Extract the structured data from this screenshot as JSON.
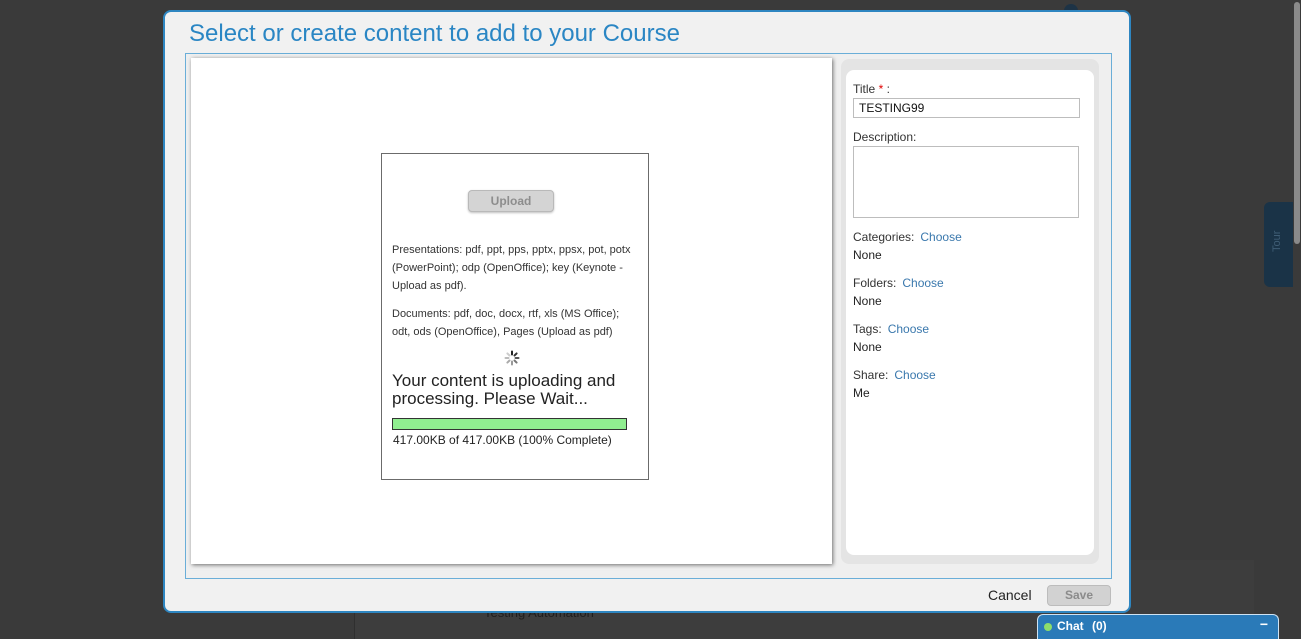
{
  "background": {
    "partial_text": "Testing Automation",
    "tour_label": "Tour"
  },
  "modal": {
    "title": "Select or create content to add to your Course",
    "upload": {
      "button_label": "Upload",
      "presentations_text": "Presentations: pdf, ppt, pps, pptx, ppsx, pot, potx (PowerPoint); odp (OpenOffice); key (Keynote - Upload as pdf).",
      "documents_text": "Documents: pdf, doc, docx, rtf, xls (MS Office); odt, ods (OpenOffice), Pages (Upload as pdf)",
      "status_message": "Your content is uploading and processing. Please Wait...",
      "progress_fraction": 1.0,
      "progress_text": "417.00KB of 417.00KB (100% Complete)",
      "progress_color": "#90ee90"
    },
    "form": {
      "title_label": "Title",
      "required_mark": "*",
      "title_label_suffix": " :",
      "title_value": "TESTING99",
      "description_label": "Description:",
      "description_value": "",
      "categories_label": "Categories:",
      "categories_value": "None",
      "folders_label": "Folders:",
      "folders_value": "None",
      "tags_label": "Tags:",
      "tags_value": "None",
      "share_label": "Share:",
      "share_value": "Me",
      "choose_label": "Choose"
    },
    "cancel_label": "Cancel",
    "save_label": "Save",
    "accent_color": "#2a86c4"
  },
  "chat": {
    "label": "Chat",
    "count": "(0)",
    "minimize_symbol": "−",
    "status_color": "#8dde6b"
  }
}
